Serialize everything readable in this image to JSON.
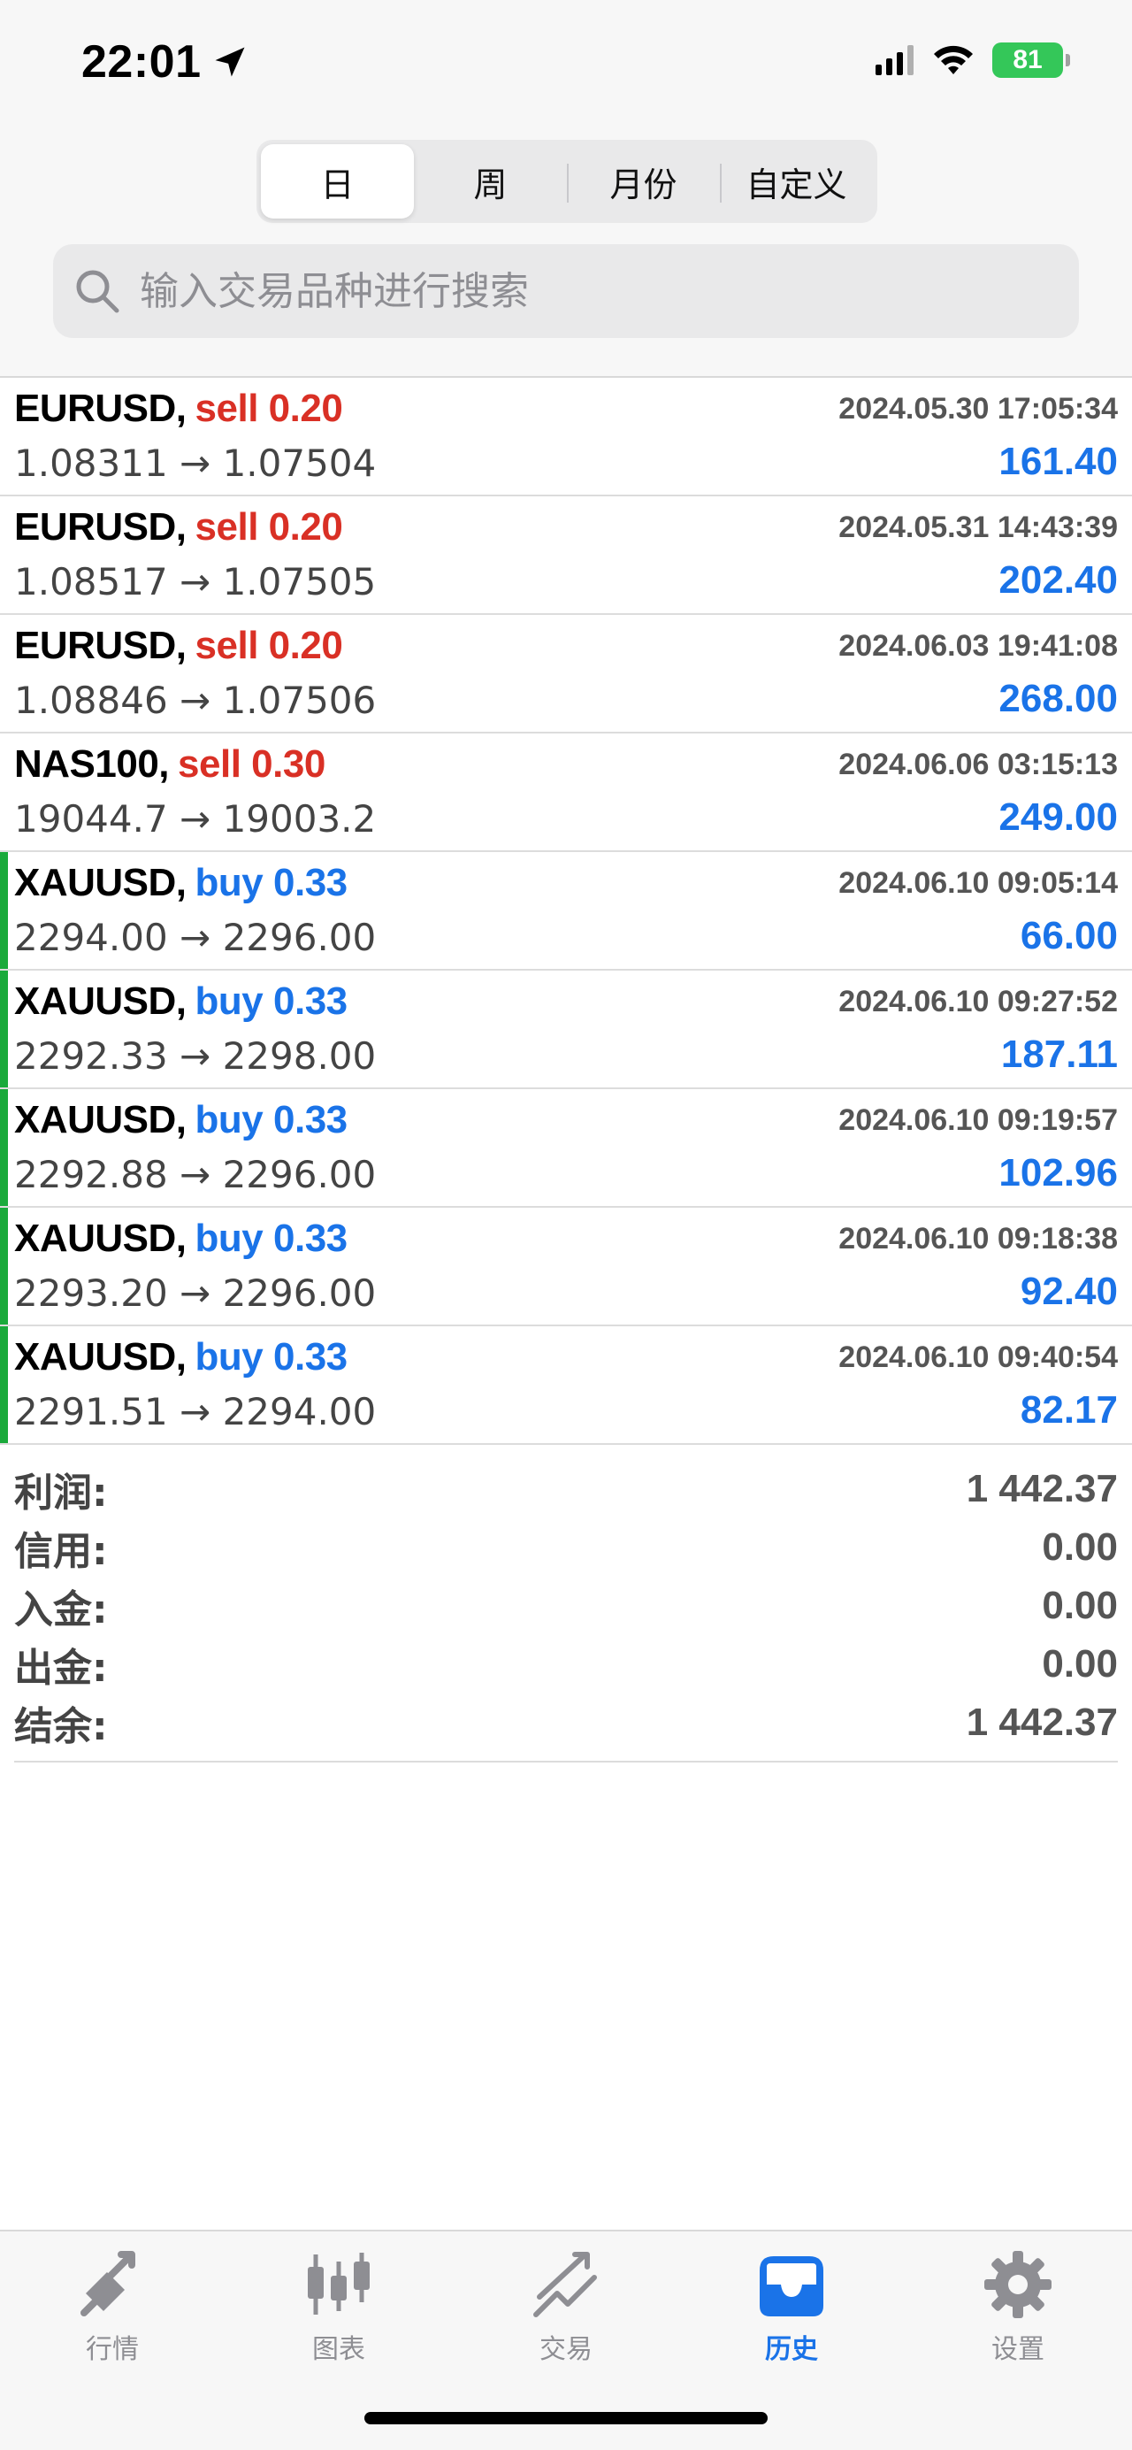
{
  "status_bar": {
    "time": "22:01",
    "battery": "81"
  },
  "segments": [
    "日",
    "周",
    "月份",
    "自定义"
  ],
  "search": {
    "placeholder": "输入交易品种进行搜索"
  },
  "trades": [
    {
      "symbol": "EURUSD,",
      "side": "sell",
      "volume": "0.20",
      "time": "2024.05.30 17:05:34",
      "prices": "1.08311 → 1.07504",
      "profit": "161.40"
    },
    {
      "symbol": "EURUSD,",
      "side": "sell",
      "volume": "0.20",
      "time": "2024.05.31 14:43:39",
      "prices": "1.08517 → 1.07505",
      "profit": "202.40"
    },
    {
      "symbol": "EURUSD,",
      "side": "sell",
      "volume": "0.20",
      "time": "2024.06.03 19:41:08",
      "prices": "1.08846 → 1.07506",
      "profit": "268.00"
    },
    {
      "symbol": "NAS100,",
      "side": "sell",
      "volume": "0.30",
      "time": "2024.06.06 03:15:13",
      "prices": "19044.7 → 19003.2",
      "profit": "249.00"
    },
    {
      "symbol": "XAUUSD,",
      "side": "buy",
      "volume": "0.33",
      "time": "2024.06.10 09:05:14",
      "prices": "2294.00 → 2296.00",
      "profit": "66.00"
    },
    {
      "symbol": "XAUUSD,",
      "side": "buy",
      "volume": "0.33",
      "time": "2024.06.10 09:27:52",
      "prices": "2292.33 → 2298.00",
      "profit": "187.11"
    },
    {
      "symbol": "XAUUSD,",
      "side": "buy",
      "volume": "0.33",
      "time": "2024.06.10 09:19:57",
      "prices": "2292.88 → 2296.00",
      "profit": "102.96"
    },
    {
      "symbol": "XAUUSD,",
      "side": "buy",
      "volume": "0.33",
      "time": "2024.06.10 09:18:38",
      "prices": "2293.20 → 2296.00",
      "profit": "92.40"
    },
    {
      "symbol": "XAUUSD,",
      "side": "buy",
      "volume": "0.33",
      "time": "2024.06.10 09:40:54",
      "prices": "2291.51 → 2294.00",
      "profit": "82.17"
    }
  ],
  "summary": [
    {
      "label": "利润:",
      "value": "1 442.37"
    },
    {
      "label": "信用:",
      "value": "0.00"
    },
    {
      "label": "入金:",
      "value": "0.00"
    },
    {
      "label": "出金:",
      "value": "0.00"
    },
    {
      "label": "结余:",
      "value": "1 442.37"
    }
  ],
  "tabs": [
    {
      "label": "行情",
      "icon": "quotes-icon"
    },
    {
      "label": "图表",
      "icon": "chart-icon"
    },
    {
      "label": "交易",
      "icon": "trade-icon"
    },
    {
      "label": "历史",
      "icon": "history-icon"
    },
    {
      "label": "设置",
      "icon": "settings-icon"
    }
  ],
  "colors": {
    "sell": "#d93025",
    "buy": "#1a73e8",
    "buy_marker": "#1aaa3b",
    "active_tab": "#1a73e8"
  }
}
